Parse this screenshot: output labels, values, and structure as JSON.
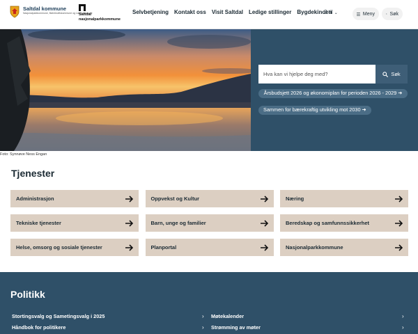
{
  "header": {
    "logo_title": "Saltdal kommune",
    "logo_subtitle": "Nasjonalparkkommune, Bærekraftskommune og Lærekommune",
    "logo2_line1": "Saltdal",
    "logo2_line2": "nasjonalparkkommune",
    "nav": [
      "Selvbetjening",
      "Kontakt oss",
      "Visit Saltdal",
      "Ledige stillinger",
      "Bygdekinoen"
    ],
    "language": "3 til",
    "menu_label": "Meny",
    "search_label": "Søk"
  },
  "hero": {
    "search_placeholder": "Hva kan vi hjelpe deg med?",
    "search_button": "Søk",
    "links": [
      "Årsbudsjett 2026 og økonomiplan for perioden 2026 - 2029",
      "Sammen for bærekraftig utvikling mot 2030"
    ],
    "photo_credit": "Foto: Synnøve Ness Engan"
  },
  "services": {
    "title": "Tjenester",
    "items": [
      "Administrasjon",
      "Oppvekst og Kultur",
      "Næring",
      "Tekniske tjenester",
      "Barn, unge og familier",
      "Beredskap og samfunnssikkerhet",
      "Helse, omsorg og sosiale tjenester",
      "Planportal",
      "Nasjonalparkkommune"
    ]
  },
  "politics": {
    "title": "Politikk",
    "items": [
      "Stortingsvalg og Sametingsvalg i 2025",
      "Møtekalender",
      "Håndbok for politikere",
      "Strømming av møter"
    ]
  },
  "colors": {
    "primary_dark": "#2f5068",
    "tile": "#dccfc2",
    "button": "#3e5e77"
  }
}
